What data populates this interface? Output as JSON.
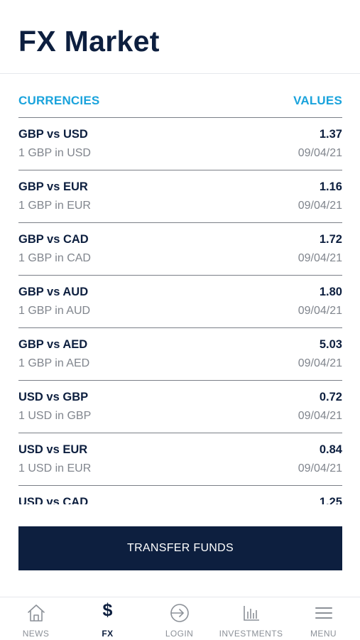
{
  "header": {
    "title": "FX Market"
  },
  "table": {
    "col_left": "CURRENCIES",
    "col_right": "VALUES",
    "rows": [
      {
        "pair": "GBP vs USD",
        "value": "1.37",
        "desc": "1 GBP in USD",
        "date": "09/04/21"
      },
      {
        "pair": "GBP vs EUR",
        "value": "1.16",
        "desc": "1 GBP in EUR",
        "date": "09/04/21"
      },
      {
        "pair": "GBP vs CAD",
        "value": "1.72",
        "desc": "1 GBP in CAD",
        "date": "09/04/21"
      },
      {
        "pair": "GBP vs AUD",
        "value": "1.80",
        "desc": "1 GBP in AUD",
        "date": "09/04/21"
      },
      {
        "pair": "GBP vs AED",
        "value": "5.03",
        "desc": "1 GBP in AED",
        "date": "09/04/21"
      },
      {
        "pair": "USD vs GBP",
        "value": "0.72",
        "desc": "1 USD in GBP",
        "date": "09/04/21"
      },
      {
        "pair": "USD vs EUR",
        "value": "0.84",
        "desc": "1 USD in EUR",
        "date": "09/04/21"
      },
      {
        "pair": "USD vs CAD",
        "value": "1.25",
        "desc": "",
        "date": ""
      }
    ]
  },
  "transfer_button": {
    "label": "TRANSFER FUNDS"
  },
  "tabbar": {
    "items": [
      {
        "label": "NEWS",
        "icon": "home-icon"
      },
      {
        "label": "FX",
        "icon": "dollar-icon",
        "active": true
      },
      {
        "label": "LOGIN",
        "icon": "login-icon"
      },
      {
        "label": "INVESTMENTS",
        "icon": "bar-chart-icon"
      },
      {
        "label": "MENU",
        "icon": "menu-icon"
      }
    ]
  },
  "colors": {
    "navy": "#0d1f3f",
    "accent": "#1aa3dc",
    "muted": "#80858d"
  }
}
